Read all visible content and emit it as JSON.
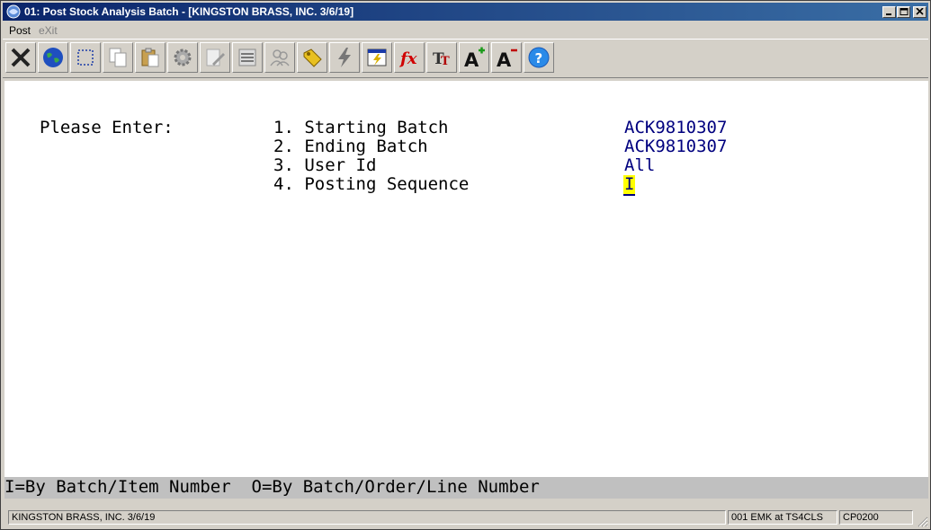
{
  "window": {
    "title": "01: Post Stock Analysis Batch - [KINGSTON BRASS, INC. 3/6/19]"
  },
  "menu": {
    "post": "Post",
    "exit": "eXit"
  },
  "toolbar": {
    "icons": [
      "close-icon",
      "globe-icon",
      "select-icon",
      "copy-icon",
      "paste-icon",
      "settings-icon",
      "edit-icon",
      "list-icon",
      "users-icon",
      "tag-icon",
      "lightning-icon",
      "calculator-icon",
      "function-icon",
      "font-size-icon",
      "font-increase-icon",
      "font-decrease-icon",
      "help-icon"
    ]
  },
  "form": {
    "prompt": "Please Enter:",
    "fields": [
      {
        "label": "1. Starting Batch",
        "value": "ACK9810307"
      },
      {
        "label": "2. Ending Batch",
        "value": "ACK9810307"
      },
      {
        "label": "3. User Id",
        "value": "All"
      },
      {
        "label": "4. Posting Sequence",
        "value": "I"
      }
    ]
  },
  "hint": "I=By Batch/Item Number  O=By Batch/Order/Line Number",
  "status": {
    "company": "KINGSTON BRASS, INC. 3/6/19",
    "session": "001 EMK at TS4CLS",
    "program": "CP0200"
  },
  "colors": {
    "value": "#00007f",
    "cursor": "#ffff00",
    "titlebar": "#0a246a"
  }
}
